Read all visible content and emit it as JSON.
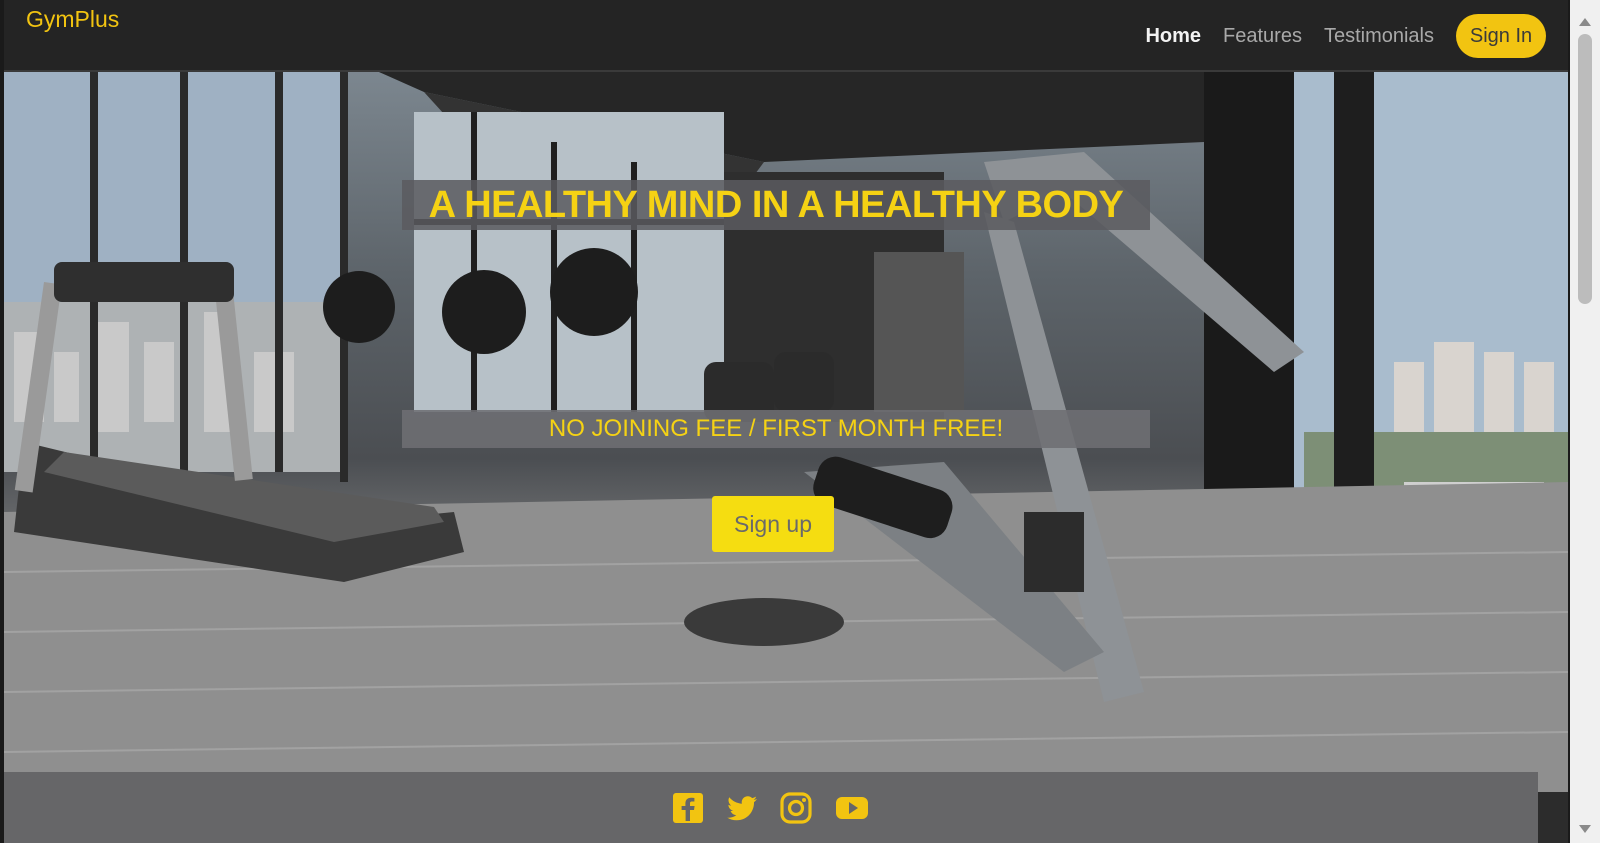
{
  "brand": "GymPlus",
  "nav": {
    "home": "Home",
    "features": "Features",
    "testimonials": "Testimonials",
    "sign_in": "Sign In"
  },
  "hero": {
    "headline": "A HEALTHY MIND IN A HEALTHY BODY",
    "tagline": "NO JOINING FEE / FIRST MONTH FREE!",
    "cta": "Sign up"
  },
  "footer": {
    "icons": [
      "facebook-icon",
      "twitter-icon",
      "instagram-icon",
      "youtube-icon"
    ]
  },
  "colors": {
    "accent": "#f2c411",
    "navbar": "#242424",
    "footer": "#666668"
  }
}
